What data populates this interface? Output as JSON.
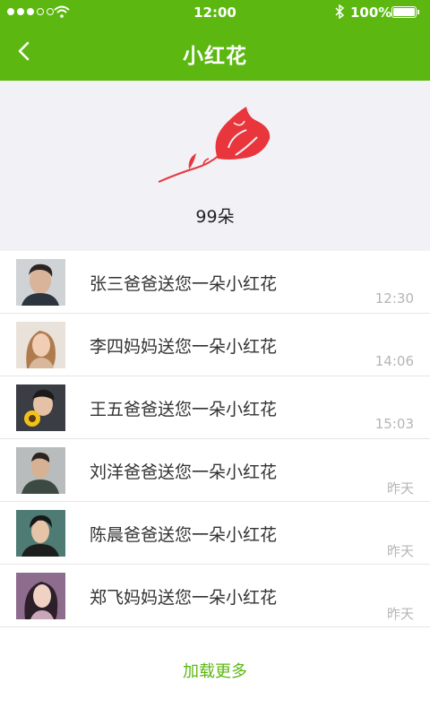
{
  "status_bar": {
    "time": "12:00",
    "battery": "100%",
    "signal_bars_filled": 3,
    "signal_bars_total": 5,
    "icons": [
      "signal-dots-icon",
      "wifi-icon",
      "bluetooth-icon",
      "battery-icon"
    ]
  },
  "nav": {
    "title": "小红花",
    "back_icon": "chevron-left-icon"
  },
  "summary": {
    "icon": "rose-icon",
    "count": "99朵"
  },
  "messages": [
    {
      "text": "张三爸爸送您一朵小红花",
      "time": "12:30",
      "avatar": "avatar-man-dark-hair"
    },
    {
      "text": "李四妈妈送您一朵小红花",
      "time": "14:06",
      "avatar": "avatar-woman-long-hair"
    },
    {
      "text": "王五爸爸送您一朵小红花",
      "time": "15:03",
      "avatar": "avatar-man-sunflower"
    },
    {
      "text": "刘洋爸爸送您一朵小红花",
      "time": "昨天",
      "avatar": "avatar-man-suit"
    },
    {
      "text": "陈晨爸爸送您一朵小红花",
      "time": "昨天",
      "avatar": "avatar-young-man"
    },
    {
      "text": "郑飞妈妈送您一朵小红花",
      "time": "昨天",
      "avatar": "avatar-woman-purple"
    }
  ],
  "load_more": "加载更多",
  "colors": {
    "accent": "#5cb811",
    "rose": "#e8363c",
    "hero_bg": "#f2f1f6",
    "time_text": "#b5b5b5"
  }
}
